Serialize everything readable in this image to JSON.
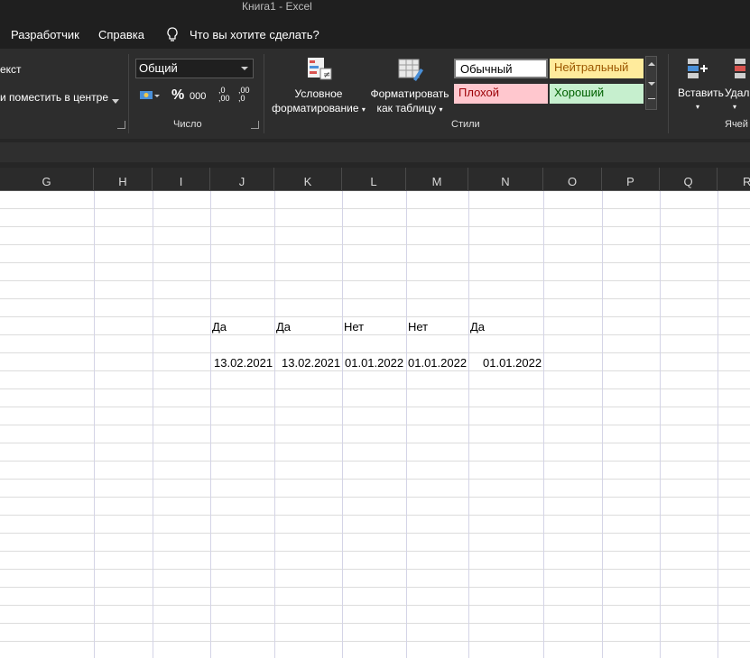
{
  "window": {
    "title": "Книга1  -  Excel"
  },
  "menu": {
    "developer": "Разработчик",
    "help": "Справка",
    "tell_me": "Что вы хотите сделать?"
  },
  "alignment": {
    "wrap_text": "екст",
    "merge_center": "и поместить в центре"
  },
  "number": {
    "format_value": "Общий",
    "percent_symbol": "%",
    "thousands_symbol": "000",
    "increase_decimal": ",0\n,00",
    "decrease_decimal": ",00\n,0",
    "group_label": "Число"
  },
  "styles": {
    "conditional_formatting_line1": "Условное",
    "conditional_formatting_line2": "форматирование",
    "format_as_table_line1": "Форматировать",
    "format_as_table_line2": "как таблицу",
    "normal": "Обычный",
    "neutral": "Нейтральный",
    "bad": "Плохой",
    "good": "Хороший",
    "group_label": "Стили",
    "colors": {
      "normal_bg": "#ffffff",
      "neutral_bg": "#ffeb9c",
      "neutral_fg": "#9c5700",
      "bad_bg": "#ffc7ce",
      "bad_fg": "#9c0006",
      "good_bg": "#c6efce",
      "good_fg": "#006100"
    }
  },
  "cells_group": {
    "insert": "Вставить",
    "delete": "Удал",
    "group_label": "Ячей"
  },
  "columns": [
    "G",
    "H",
    "I",
    "J",
    "K",
    "L",
    "M",
    "N",
    "O",
    "P",
    "Q",
    "R"
  ],
  "sheet": {
    "row_a": [
      "Да",
      "Да",
      "Нет",
      "Нет",
      "Да"
    ],
    "row_b": [
      "13.02.2021",
      "13.02.2021",
      "01.01.2022",
      "01.01.2022",
      "01.01.2022"
    ]
  }
}
